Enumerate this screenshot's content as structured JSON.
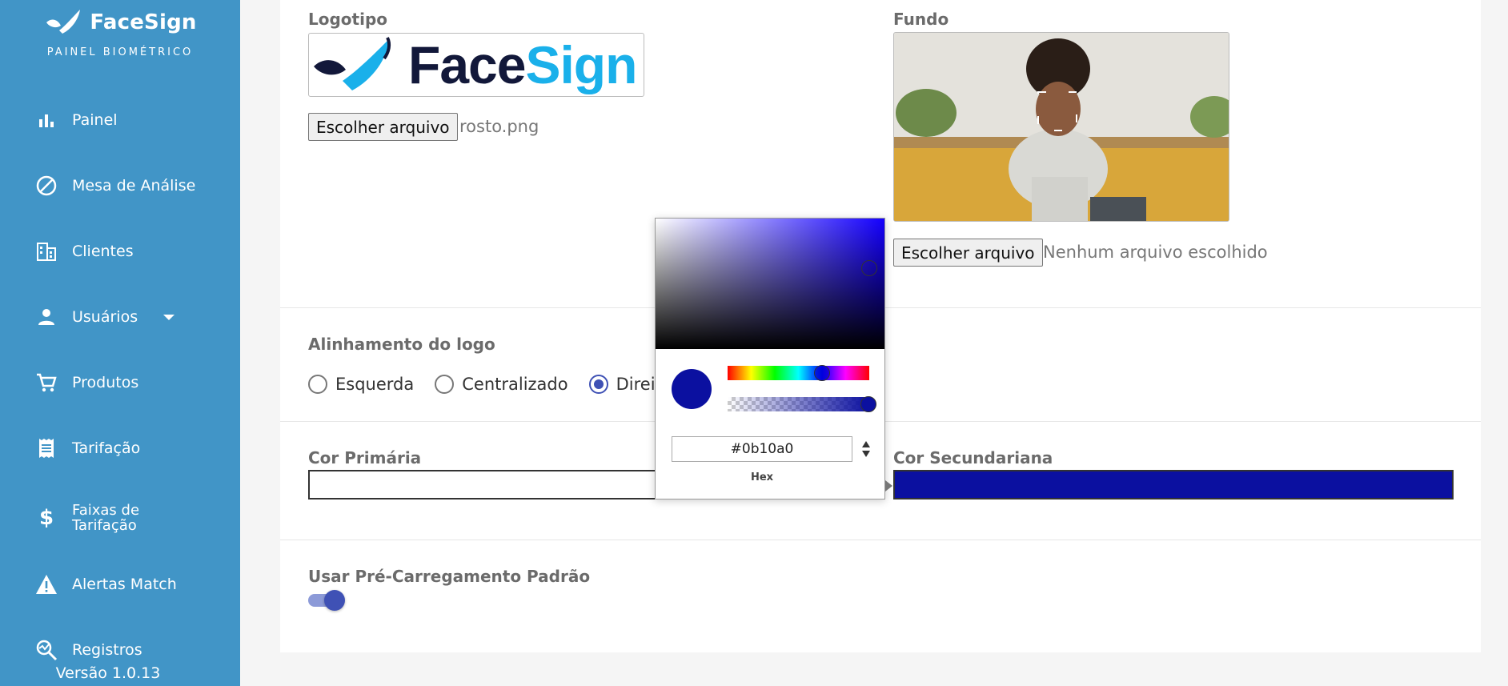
{
  "sidebar": {
    "brand_name": "FaceSign",
    "brand_subtitle": "PAINEL BIOMÉTRICO",
    "items": [
      {
        "label": "Painel",
        "icon": "bar-chart-icon"
      },
      {
        "label": "Mesa de Análise",
        "icon": "block-icon"
      },
      {
        "label": "Clientes",
        "icon": "building-icon"
      },
      {
        "label": "Usuários",
        "icon": "person-icon"
      },
      {
        "label": "Produtos",
        "icon": "cart-icon"
      },
      {
        "label": "Tarifação",
        "icon": "receipt-icon"
      },
      {
        "label_line1": "Faixas de",
        "label_line2": "Tarifação",
        "icon": "dollar-icon"
      },
      {
        "label": "Alertas Match",
        "icon": "warning-icon"
      },
      {
        "label": "Registros",
        "icon": "query-stats-icon"
      }
    ],
    "version": "Versão 1.0.13"
  },
  "logo_section": {
    "label": "Logotipo",
    "logo_text_dark": "Face",
    "logo_text_light": "Sign",
    "button_label": "Escolher arquivo",
    "file_name": "rosto.png"
  },
  "background_section": {
    "label": "Fundo",
    "button_label": "Escolher arquivo",
    "file_name": "Nenhum arquivo escolhido"
  },
  "alignment": {
    "label": "Alinhamento do logo",
    "options": [
      "Esquerda",
      "Centralizado",
      "Direita"
    ],
    "selected": "Direita"
  },
  "colors": {
    "primary_label": "Cor Primária",
    "secondary_label": "Cor Secundariana",
    "secondary_value": "#0b10a0",
    "brand_dark": "#12183a",
    "brand_light": "#1ab0ea",
    "sidebar_bg": "#4195c7",
    "accent": "#3f51b5"
  },
  "picker": {
    "hex_value": "#0b10a0",
    "mode_label": "Hex"
  },
  "preload": {
    "label": "Usar Pré-Carregamento Padrão",
    "enabled": true
  }
}
